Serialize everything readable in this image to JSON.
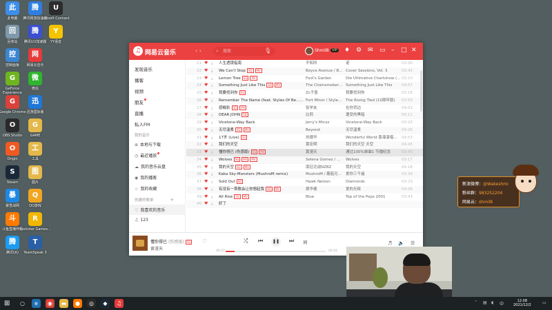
{
  "desktop_icons": [
    {
      "label": "此电脑",
      "icon": "computer-icon",
      "color": "#3d8ee8"
    },
    {
      "label": "腾讯网游加速器",
      "icon": "tencent-accelerator-icon",
      "color": "#2f7fe0"
    },
    {
      "label": "Ubisoft Connect",
      "icon": "ubisoft-icon",
      "color": "#2c2c2c"
    },
    {
      "label": "回收站",
      "icon": "recycle-bin-icon",
      "color": "#7f98aa"
    },
    {
      "label": "腾讯UU加速器",
      "icon": "uu-accelerator-icon",
      "color": "#3b4fd0"
    },
    {
      "label": "YY语音",
      "icon": "yy-voice-icon",
      "color": "#f5c400"
    },
    {
      "label": "控制面板",
      "icon": "control-panel-icon",
      "color": "#3b86d3"
    },
    {
      "label": "网易云音乐",
      "icon": "netease-music-icon",
      "color": "#e63b3b"
    },
    {
      "label": "GeForce Experience",
      "icon": "geforce-icon",
      "color": "#6fb51f"
    },
    {
      "label": "微信",
      "icon": "wechat-icon",
      "color": "#2fb52f"
    },
    {
      "label": "Google Chrome",
      "icon": "chrome-icon",
      "color": "#d9423a"
    },
    {
      "label": "迅游国际版",
      "icon": "xunyou-icon",
      "color": "#1f77d6"
    },
    {
      "label": "OBS Studio",
      "icon": "obs-icon",
      "color": "#2a2a2a"
    },
    {
      "label": "GAME",
      "icon": "game-folder-icon",
      "color": "#e4b84a"
    },
    {
      "label": "Origin",
      "icon": "origin-icon",
      "color": "#f05a22"
    },
    {
      "label": "工具",
      "icon": "tools-folder-icon",
      "color": "#e4b84a"
    },
    {
      "label": "Steam",
      "icon": "steam-icon",
      "color": "#1b2838"
    },
    {
      "label": "图片",
      "icon": "pictures-folder-icon",
      "color": "#e4b84a"
    },
    {
      "label": "暴雪战网",
      "icon": "battlenet-icon",
      "color": "#1e88e5"
    },
    {
      "label": "QQ游戏",
      "icon": "qq-game-icon",
      "color": "#f1a623"
    },
    {
      "label": "斗鱼直播伴侣",
      "icon": "douyu-icon",
      "color": "#ff7a00"
    },
    {
      "label": "Rockstar Games...",
      "icon": "rockstar-icon",
      "color": "#f2b705"
    },
    {
      "label": "腾讯QQ",
      "icon": "qq-icon",
      "color": "#1d9bf0"
    },
    {
      "label": "TeamSpeak 3",
      "icon": "teamspeak-icon",
      "color": "#2a5fa8"
    }
  ],
  "app": {
    "name": "网易云音乐",
    "search_placeholder": "搜索",
    "username": "Shmil8",
    "vip_badge": "VIP"
  },
  "sidebar": {
    "items": [
      "发现音乐",
      "播客",
      "视频",
      "朋友",
      "直播",
      "私人FM"
    ],
    "my_music_header": "我的音乐",
    "my_music": [
      "本地与下载",
      "最近播放",
      "我的音乐云盘",
      "我的播客",
      "我的收藏"
    ],
    "created_header": "创建的歌单",
    "playlists": [
      "我喜欢的音乐",
      "123"
    ]
  },
  "songs": [
    {
      "num": "21",
      "title": "人生透镜指南",
      "tags": [],
      "artist": "不知所",
      "album": "诺",
      "dur": "03:30"
    },
    {
      "num": "22",
      "title": "We Can't Stop",
      "tags": [
        "SQ",
        "MV"
      ],
      "artist": "Boyce Avenue / Be...",
      "album": "Cover Sessions, Vol. 3",
      "dur": "03:42"
    },
    {
      "num": "23",
      "title": "Lemon Tree",
      "tags": [
        "SQ",
        "MV"
      ],
      "artist": "Fool's Garden",
      "album": "Die Ultimative Chartshow (Bi...",
      "dur": "03:10"
    },
    {
      "num": "24",
      "title": "Something Just Like This",
      "tags": [
        "SQ",
        "MV"
      ],
      "artist": "The Chainsmokers /...",
      "album": "Something Just Like This",
      "dur": "04:07"
    },
    {
      "num": "25",
      "title": "我要找到你",
      "tags": [
        "SQ"
      ],
      "artist": "Zc子墨",
      "album": "我要找到你",
      "dur": "03:18"
    },
    {
      "num": "26",
      "title": "Remember The Name (feat. Styles Of Be...",
      "tags": [
        "SQ"
      ],
      "artist": "Fort Minor / Styles ...",
      "album": "The Rising Tied (10周年版)",
      "dur": "03:50"
    },
    {
      "num": "27",
      "title": "感概影",
      "tags": [
        "SQ",
        "MV"
      ],
      "artist": "张学友",
      "album": "在你背边",
      "dur": "04:03"
    },
    {
      "num": "28",
      "title": "DEAR JOHN",
      "tags": [
        "SQ"
      ],
      "artist": "比莉",
      "album": "遭受的黑暗",
      "dur": "05:11"
    },
    {
      "num": "29",
      "title": "Vicetone-Way Back",
      "tags": [],
      "artist": "Jerry's Minzz",
      "album": "Vicetone-Way Back",
      "dur": "03:23"
    },
    {
      "num": "30",
      "title": "无尽温柔",
      "tags": [
        "SQ",
        "MV"
      ],
      "artist": "Beyond",
      "album": "无尽温柔",
      "dur": "04:26"
    },
    {
      "num": "31",
      "title": "17岁 (Live)",
      "tags": [
        "SQ"
      ],
      "artist": "刘德华",
      "album": "Wonderful World 香港演唱会...",
      "dur": "04:53"
    },
    {
      "num": "32",
      "title": "我们的天空",
      "tags": [],
      "artist": "黄宏明",
      "album": "我们的天空 天空",
      "dur": "04:45"
    },
    {
      "num": "33",
      "title": "懂你得已 (伤感版)",
      "tags": [
        "SQ",
        "MV"
      ],
      "artist": "黄漫天",
      "album": "通过100%单曲1 节播纪念",
      "dur": "03:40"
    },
    {
      "num": "34",
      "title": "Wolves",
      "tags": [
        "SQ",
        "MV",
        "MV"
      ],
      "artist": "Selena Gomez / Ma...",
      "album": "Wolves",
      "dur": "03:17"
    },
    {
      "num": "35",
      "title": "我的天空",
      "tags": [
        "SQ",
        "MV"
      ],
      "artist": "南征北战NZBZ",
      "album": "我的天空",
      "dur": "04:18"
    },
    {
      "num": "36",
      "title": "Kaka Sky-Monsters (MushroM remix)",
      "tags": [],
      "artist": "MushroM / 蘑菇兄...",
      "album": "爱你三千遍",
      "dur": "03:39"
    },
    {
      "num": "37",
      "title": "Sold Out",
      "tags": [
        "SQ"
      ],
      "artist": "Hawk Nelson",
      "album": "Diamonds",
      "dur": "03:23"
    },
    {
      "num": "38",
      "title": "有没有一首歌会让你想起我",
      "tags": [
        "SQ",
        "MV"
      ],
      "artist": "周华健",
      "album": "爱的光辉",
      "dur": "04:06"
    },
    {
      "num": "39",
      "title": "All Rise",
      "tags": [
        "SQ",
        "MV"
      ],
      "artist": "Blue",
      "album": "Top of the Pops 2001",
      "dur": "03:43"
    },
    {
      "num": "40",
      "title": "好了",
      "tags": [],
      "artist": "",
      "album": "",
      "dur": ""
    }
  ],
  "player": {
    "title": "懂你得已",
    "subtitle": "(伤感版)",
    "tag": "SQ",
    "artist": "黄漫天",
    "elapsed": "00:22",
    "total": "04:01",
    "progress": 0.09
  },
  "overlay": {
    "lines": [
      {
        "label": "新浪微博：",
        "value": "@Wakeshmi"
      },
      {
        "label": "粉丝群：",
        "value": "983252204"
      },
      {
        "label": "网易云：",
        "value": "shmil8"
      }
    ]
  },
  "taskbar": {
    "time": "12:08",
    "date": "2021/12/2"
  },
  "colors": {
    "accent": "#ec4141",
    "overlay_value": "#f7a035"
  }
}
